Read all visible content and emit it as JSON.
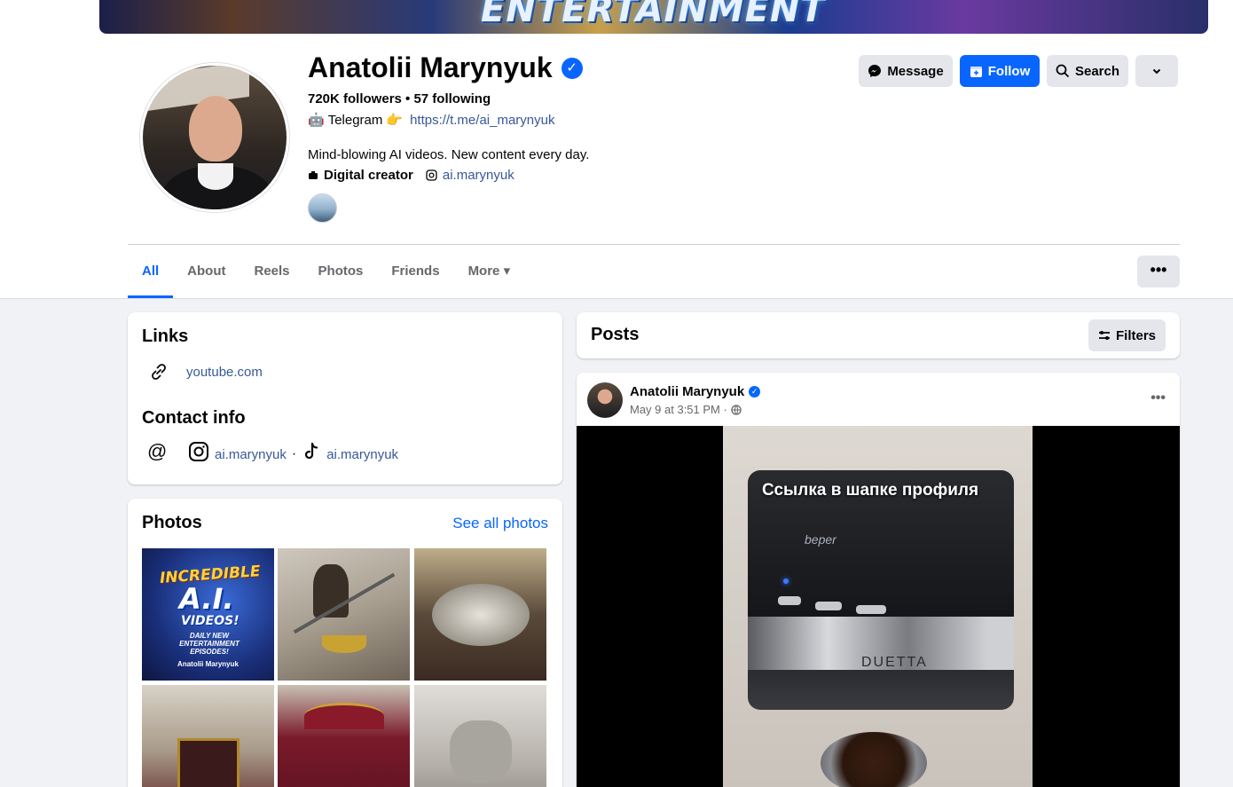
{
  "cover": {
    "text": "ENTERTAINMENT"
  },
  "profile": {
    "name": "Anatolii Marynyuk",
    "verified_symbol": "✓",
    "stats": "720K followers • 57 following",
    "telegram_label": "Telegram",
    "telegram_emoji_left": "🤖",
    "telegram_emoji_right": "👉",
    "telegram_link": "https://t.me/ai_marynyuk",
    "bio": "Mind-blowing AI videos. New content every day.",
    "category": "Digital creator",
    "instagram": "ai.marynyuk"
  },
  "actions": {
    "message": "Message",
    "follow": "Follow",
    "search": "Search",
    "more_chevron": "⌄"
  },
  "tabs": [
    {
      "label": "All",
      "active": true
    },
    {
      "label": "About"
    },
    {
      "label": "Reels"
    },
    {
      "label": "Photos"
    },
    {
      "label": "Friends"
    },
    {
      "label": "More ▾"
    }
  ],
  "tabs_more_dots": "•••",
  "links_card": {
    "title": "Links",
    "youtube": "youtube.com",
    "contact_title": "Contact info",
    "instagram": "ai.marynyuk",
    "separator": "·",
    "tiktok": "ai.marynyuk"
  },
  "photos_card": {
    "title": "Photos",
    "see_all": "See all photos",
    "tile1_line1": "INCREDIBLE",
    "tile1_line2": "A.I.",
    "tile1_line3": "VIDEOS!",
    "tile1_line4": "DAILY NEW ENTERTAINMENT EPISODES!",
    "tile1_line5": "Anatolii Marynyuk"
  },
  "posts_card": {
    "title": "Posts",
    "filters": "Filters"
  },
  "post": {
    "author": "Anatolii Marynyuk",
    "time": "May 9 at 3:51 PM ·",
    "menu": "•••",
    "overlay_text": "Ссылка в шапке профиля",
    "brand1": "beper",
    "brand2": "DUETTA"
  },
  "colors": {
    "accent": "#0866ff",
    "link": "#385898",
    "bg": "#f0f2f5"
  }
}
